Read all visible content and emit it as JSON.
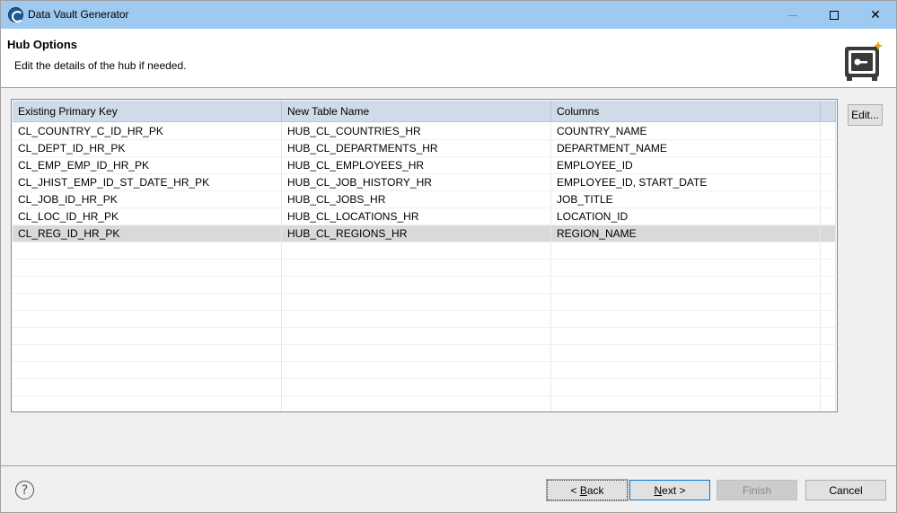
{
  "window": {
    "title": "Data Vault Generator"
  },
  "header": {
    "title": "Hub Options",
    "description": "Edit the details of the hub if needed."
  },
  "table": {
    "columns": [
      "Existing Primary Key",
      "New Table Name",
      "Columns"
    ],
    "rows": [
      {
        "pk": "CL_COUNTRY_C_ID_HR_PK",
        "table": "HUB_CL_COUNTRIES_HR",
        "columns": "COUNTRY_NAME"
      },
      {
        "pk": "CL_DEPT_ID_HR_PK",
        "table": "HUB_CL_DEPARTMENTS_HR",
        "columns": "DEPARTMENT_NAME"
      },
      {
        "pk": "CL_EMP_EMP_ID_HR_PK",
        "table": "HUB_CL_EMPLOYEES_HR",
        "columns": "EMPLOYEE_ID"
      },
      {
        "pk": "CL_JHIST_EMP_ID_ST_DATE_HR_PK",
        "table": "HUB_CL_JOB_HISTORY_HR",
        "columns": "EMPLOYEE_ID, START_DATE"
      },
      {
        "pk": "CL_JOB_ID_HR_PK",
        "table": "HUB_CL_JOBS_HR",
        "columns": "JOB_TITLE"
      },
      {
        "pk": "CL_LOC_ID_HR_PK",
        "table": "HUB_CL_LOCATIONS_HR",
        "columns": "LOCATION_ID"
      },
      {
        "pk": "CL_REG_ID_HR_PK",
        "table": "HUB_CL_REGIONS_HR",
        "columns": "REGION_NAME",
        "selected": true
      }
    ]
  },
  "buttons": {
    "edit": "Edit...",
    "back_prefix": "< ",
    "back_key": "B",
    "back_rest": "ack",
    "next_key": "N",
    "next_rest": "ext >",
    "finish": "Finish",
    "cancel": "Cancel",
    "help": "?"
  },
  "icons": {
    "app": "data-vault-app-icon",
    "vault": "safe-vault-icon",
    "help": "help-icon"
  },
  "colors": {
    "titlebar": "#9ec9f0",
    "header_row": "#cfdbe8",
    "selected_row": "#d9d9d9",
    "default_button_border": "#0078d7"
  }
}
